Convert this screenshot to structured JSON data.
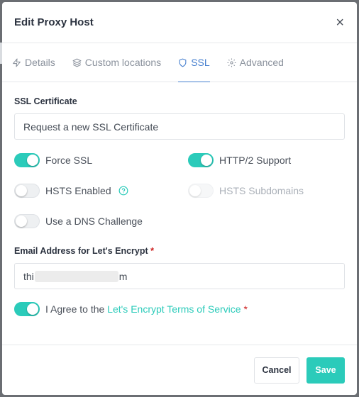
{
  "modal": {
    "title": "Edit Proxy Host",
    "close_glyph": "×"
  },
  "tabs": [
    {
      "label": "Details",
      "icon": "zap-icon",
      "active": false
    },
    {
      "label": "Custom locations",
      "icon": "layers-icon",
      "active": false
    },
    {
      "label": "SSL",
      "icon": "shield-icon",
      "active": true
    },
    {
      "label": "Advanced",
      "icon": "gear-icon",
      "active": false
    }
  ],
  "ssl": {
    "certificate_label": "SSL Certificate",
    "certificate_value": "Request a new SSL Certificate",
    "force_ssl": {
      "label": "Force SSL",
      "on": true
    },
    "http2": {
      "label": "HTTP/2 Support",
      "on": true
    },
    "hsts": {
      "label": "HSTS Enabled",
      "on": false
    },
    "hsts_sub": {
      "label": "HSTS Subdomains",
      "on": false,
      "disabled": true
    },
    "dns_challenge": {
      "label": "Use a DNS Challenge",
      "on": false
    },
    "email_label": "Email Address for Let's Encrypt",
    "required_mark": "*",
    "email_prefix": "thi",
    "email_suffix": "m",
    "agree_prefix": "I Agree to the ",
    "agree_link": "Let's Encrypt Terms of Service",
    "agree_on": true
  },
  "footer": {
    "cancel_label": "Cancel",
    "save_label": "Save"
  },
  "colors": {
    "accent": "#2bcbba",
    "tab_active": "#467fcf",
    "required": "#cd201f"
  }
}
